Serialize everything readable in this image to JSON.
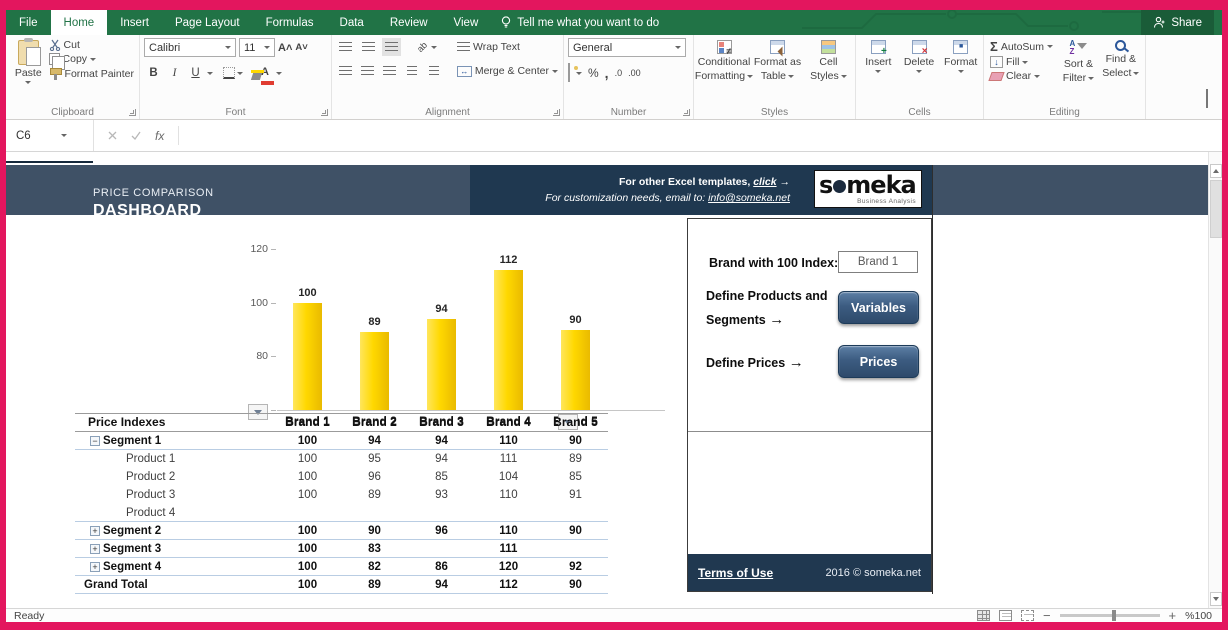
{
  "ribbon_tabs": {
    "items": [
      "File",
      "Home",
      "Insert",
      "Page Layout",
      "Formulas",
      "Data",
      "Review",
      "View"
    ],
    "active": "Home",
    "tell_me": "Tell me what you want to do",
    "share": "Share"
  },
  "ribbon": {
    "clipboard": {
      "group": "Clipboard",
      "paste": "Paste",
      "cut": "Cut",
      "copy": "Copy",
      "format_painter": "Format Painter"
    },
    "font": {
      "group": "Font",
      "name": "Calibri",
      "size": "11",
      "bold": "B",
      "italic": "I",
      "underline": "U"
    },
    "alignment": {
      "group": "Alignment",
      "wrap": "Wrap Text",
      "merge": "Merge & Center"
    },
    "number": {
      "group": "Number",
      "format": "General",
      "percent": "%",
      "comma": ",",
      "inc_decimal": ".0",
      "dec_decimal": ".00"
    },
    "styles": {
      "group": "Styles",
      "cf1": "Conditional",
      "cf2": "Formatting",
      "fat1": "Format as",
      "fat2": "Table",
      "cs1": "Cell",
      "cs2": "Styles"
    },
    "cells": {
      "group": "Cells",
      "insert": "Insert",
      "delete": "Delete",
      "format": "Format"
    },
    "editing": {
      "group": "Editing",
      "autosum": "AutoSum",
      "fill": "Fill",
      "clear": "Clear",
      "sort1": "Sort &",
      "sort2": "Filter",
      "find1": "Find &",
      "find2": "Select"
    }
  },
  "formula_bar": {
    "name_box": "C6",
    "fx": "fx"
  },
  "dashboard": {
    "header": {
      "title_small": "PRICE COMPARISON",
      "title_big": "DASHBOARD",
      "promo_prefix": "For other Excel templates, ",
      "promo_click": "click",
      "promo_arrow": "→",
      "custom_prefix": "For customization needs, email to: ",
      "custom_link": "info@someka.net",
      "logo_first": "s",
      "logo_rest": "meka",
      "logo_sub": "Business Analysis"
    },
    "panel": {
      "brand_label": "Brand with 100 Index:",
      "brand_value": "Brand 1",
      "def_products_1": "Define Products and",
      "def_products_2": "Segments",
      "arrow": "→",
      "btn_variables": "Variables",
      "def_prices": "Define Prices",
      "btn_prices": "Prices"
    },
    "footer": {
      "terms": "Terms of Use",
      "copyright": "2016 © someka.net"
    }
  },
  "chart_data": {
    "type": "bar",
    "title": "",
    "categories": [
      "Brand 1",
      "Brand 2",
      "Brand 3",
      "Brand 4",
      "Brand 5"
    ],
    "values": [
      100,
      89,
      94,
      112,
      90
    ],
    "y_ticks": [
      60,
      80,
      100,
      120
    ],
    "ylim": [
      60,
      120
    ],
    "bar_color": "#FFD800",
    "grid": false,
    "legend": false
  },
  "table": {
    "title": "Price Indexes",
    "columns": [
      "Brand 1",
      "Brand 2",
      "Brand 3",
      "Brand 4",
      "Brand 5"
    ],
    "rows": [
      {
        "label": "Segment 1",
        "type": "segment",
        "expand": "−",
        "divider": true,
        "values": [
          "100",
          "94",
          "94",
          "110",
          "90"
        ]
      },
      {
        "label": "Product 1",
        "type": "product",
        "expand": "",
        "divider": false,
        "values": [
          "100",
          "95",
          "94",
          "111",
          "89"
        ]
      },
      {
        "label": "Product 2",
        "type": "product",
        "expand": "",
        "divider": false,
        "values": [
          "100",
          "96",
          "85",
          "104",
          "85"
        ]
      },
      {
        "label": "Product 3",
        "type": "product",
        "expand": "",
        "divider": false,
        "values": [
          "100",
          "89",
          "93",
          "110",
          "91"
        ]
      },
      {
        "label": "Product 4",
        "type": "product",
        "expand": "",
        "divider": true,
        "values": [
          "",
          "",
          "",
          "",
          ""
        ]
      },
      {
        "label": "Segment 2",
        "type": "segment",
        "expand": "+",
        "divider": true,
        "values": [
          "100",
          "90",
          "96",
          "110",
          "90"
        ]
      },
      {
        "label": "Segment 3",
        "type": "segment",
        "expand": "+",
        "divider": true,
        "values": [
          "100",
          "83",
          "",
          "111",
          ""
        ]
      },
      {
        "label": "Segment 4",
        "type": "segment",
        "expand": "+",
        "divider": true,
        "values": [
          "100",
          "82",
          "86",
          "120",
          "92"
        ]
      },
      {
        "label": "Grand Total",
        "type": "total",
        "expand": "",
        "divider": true,
        "values": [
          "100",
          "89",
          "94",
          "112",
          "90"
        ]
      }
    ]
  },
  "status_bar": {
    "ready": "Ready",
    "zoom_level": "%100"
  }
}
